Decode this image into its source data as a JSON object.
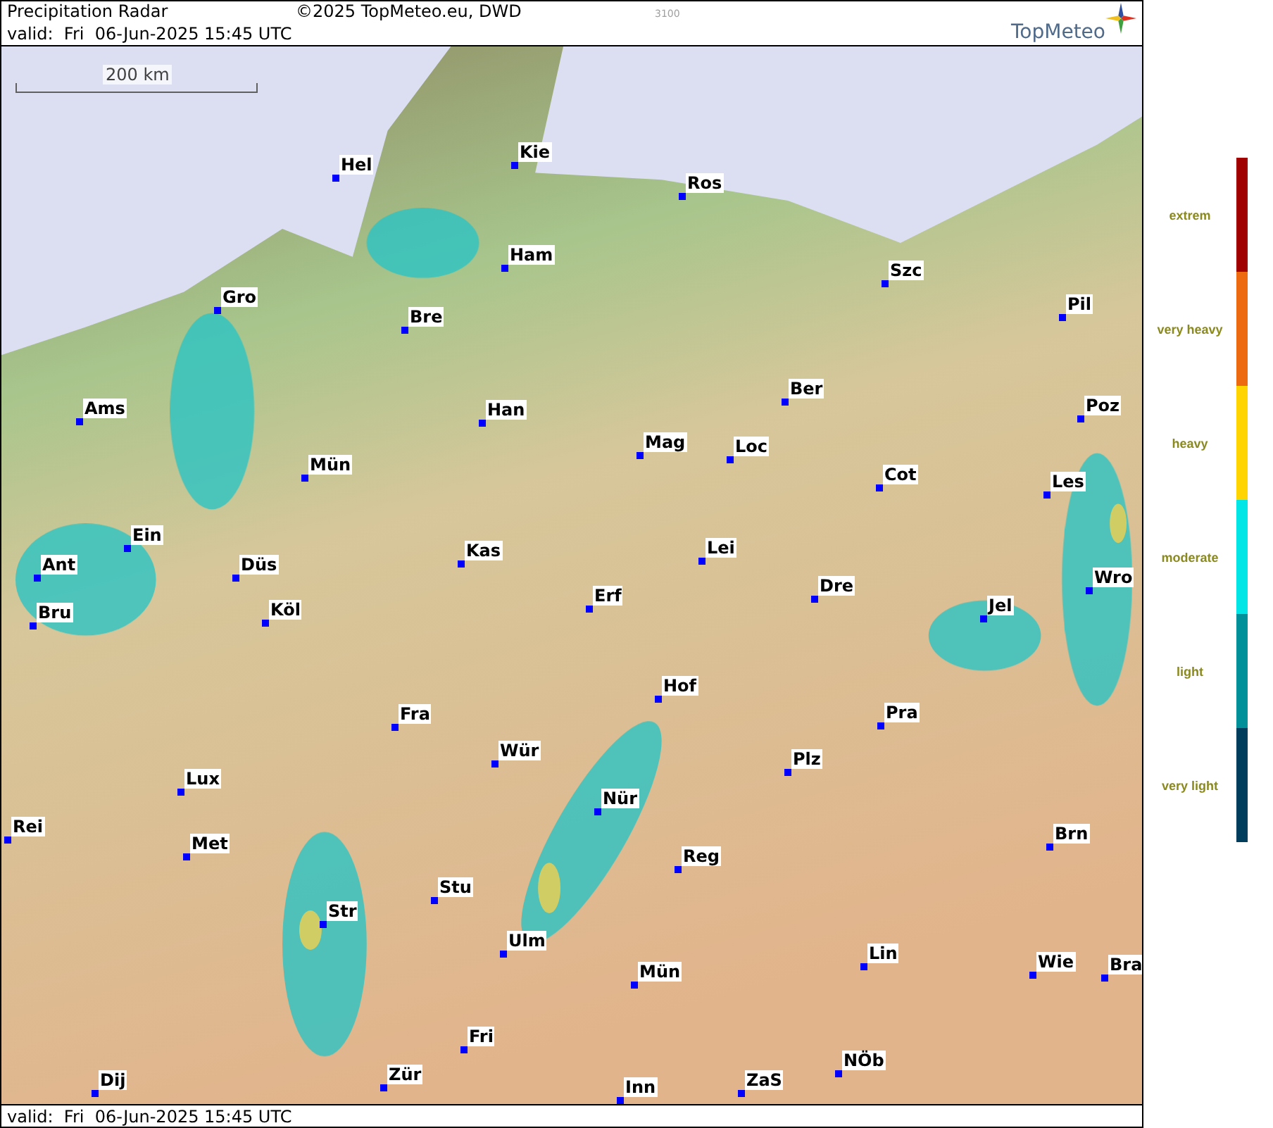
{
  "header": {
    "title": "Precipitation Radar",
    "copyright": "©2025 TopMeteo.eu, DWD",
    "code": "3100",
    "valid": "valid:  Fri  06-Jun-2025 15:45 UTC",
    "logo": "TopMeteo"
  },
  "map": {
    "scale": "200 km",
    "cities": [
      {
        "name": "Hel"
      },
      {
        "name": "Kie"
      },
      {
        "name": "Ros"
      },
      {
        "name": "Ham"
      },
      {
        "name": "Szc"
      },
      {
        "name": "Gro"
      },
      {
        "name": "Bre"
      },
      {
        "name": "Pil"
      },
      {
        "name": "Ber"
      },
      {
        "name": "Ams"
      },
      {
        "name": "Han"
      },
      {
        "name": "Poz"
      },
      {
        "name": "Mag"
      },
      {
        "name": "Loc"
      },
      {
        "name": "Mün"
      },
      {
        "name": "Cot"
      },
      {
        "name": "Les"
      },
      {
        "name": "Ein"
      },
      {
        "name": "Kas"
      },
      {
        "name": "Lei"
      },
      {
        "name": "Ant"
      },
      {
        "name": "Düs"
      },
      {
        "name": "Wro"
      },
      {
        "name": "Erf"
      },
      {
        "name": "Dre"
      },
      {
        "name": "Bru"
      },
      {
        "name": "Köl"
      },
      {
        "name": "Jel"
      },
      {
        "name": "Hof"
      },
      {
        "name": "Fra"
      },
      {
        "name": "Pra"
      },
      {
        "name": "Wür"
      },
      {
        "name": "Plz"
      },
      {
        "name": "Lux"
      },
      {
        "name": "Nür"
      },
      {
        "name": "Rei"
      },
      {
        "name": "Met"
      },
      {
        "name": "Reg"
      },
      {
        "name": "Brn"
      },
      {
        "name": "Stu"
      },
      {
        "name": "Str"
      },
      {
        "name": "Ulm"
      },
      {
        "name": "Lin"
      },
      {
        "name": "Mün"
      },
      {
        "name": "Wie"
      },
      {
        "name": "Bra"
      },
      {
        "name": "Fri"
      },
      {
        "name": "NÖb"
      },
      {
        "name": "Dij"
      },
      {
        "name": "Zür"
      },
      {
        "name": "Inn"
      },
      {
        "name": "ZaS"
      }
    ]
  },
  "legend": [
    {
      "label": "extrem",
      "color": "#a00000"
    },
    {
      "label": "very heavy",
      "color": "#ee6a10"
    },
    {
      "label": "heavy",
      "color": "#ffd400"
    },
    {
      "label": "moderate",
      "color": "#00e5e5"
    },
    {
      "label": "light",
      "color": "#00909a"
    },
    {
      "label": "very light",
      "color": "#003d5c"
    }
  ],
  "footer": {
    "valid": "valid:  Fri  06-Jun-2025 15:45 UTC"
  }
}
